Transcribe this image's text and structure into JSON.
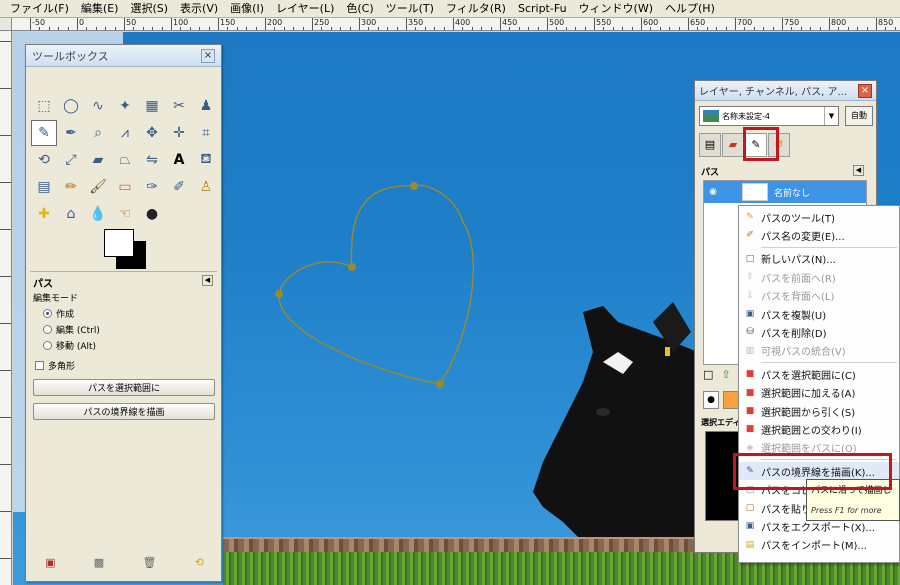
{
  "menubar": {
    "items": [
      "ファイル(F)",
      "編集(E)",
      "選択(S)",
      "表示(V)",
      "画像(I)",
      "レイヤー(L)",
      "色(C)",
      "ツール(T)",
      "フィルタ(R)",
      "Script-Fu",
      "ウィンドウ(W)",
      "ヘルプ(H)"
    ]
  },
  "ruler": {
    "top_labels": [
      "-50",
      "0",
      "50",
      "100",
      "150",
      "200",
      "250",
      "300",
      "350",
      "400",
      "450",
      "500",
      "550",
      "600",
      "650",
      "700",
      "750",
      "800",
      "850"
    ]
  },
  "toolbox": {
    "title": "ツールボックス",
    "close": "×",
    "options": {
      "title": "パス",
      "edit_mode_label": "編集モード",
      "modes": [
        "作成",
        "編集 (Ctrl)",
        "移動 (Alt)"
      ],
      "selected_mode": "作成",
      "polygon_label": "多角形",
      "btn_to_selection": "パスを選択範囲に",
      "btn_stroke": "パスの境界線を描画"
    }
  },
  "dock": {
    "title": "レイヤー, チャンネル, パス, ア...",
    "close": "×",
    "image_name": "名称未設定-4",
    "auto_label": "自動",
    "paths_title": "パス",
    "path_name": "名前なし",
    "selection_editor_label": "選択エディ"
  },
  "context_menu": {
    "items": [
      {
        "label": "パスのツール(T)",
        "enabled": true
      },
      {
        "label": "パス名の変更(E)...",
        "enabled": true
      },
      {
        "label": "新しいパス(N)...",
        "enabled": true
      },
      {
        "label": "パスを前面へ(R)",
        "enabled": false
      },
      {
        "label": "パスを背面へ(L)",
        "enabled": false
      },
      {
        "label": "パスを複製(U)",
        "enabled": true
      },
      {
        "label": "パスを削除(D)",
        "enabled": true
      },
      {
        "label": "可視パスの統合(V)",
        "enabled": false
      },
      {
        "label": "パスを選択範囲に(C)",
        "enabled": true
      },
      {
        "label": "選択範囲に加える(A)",
        "enabled": true
      },
      {
        "label": "選択範囲から引く(S)",
        "enabled": true
      },
      {
        "label": "選択範囲との交わり(I)",
        "enabled": true
      },
      {
        "label": "選択範囲をパスに(O)",
        "enabled": false
      },
      {
        "label": "パスの境界線を描画(K)...",
        "enabled": true
      },
      {
        "label": "パスをコピー",
        "enabled": true
      },
      {
        "label": "パスを貼り付",
        "enabled": true
      },
      {
        "label": "パスをエクスポート(X)...",
        "enabled": true
      },
      {
        "label": "パスをインポート(M)...",
        "enabled": true
      }
    ]
  },
  "tooltip": {
    "line1": "パスに沿って描画し",
    "line2": "Press F1 for more"
  },
  "colors": {
    "annotation": "#c4141c",
    "path_stroke": "#9b8b2a",
    "sky": "#1f7fc9"
  }
}
